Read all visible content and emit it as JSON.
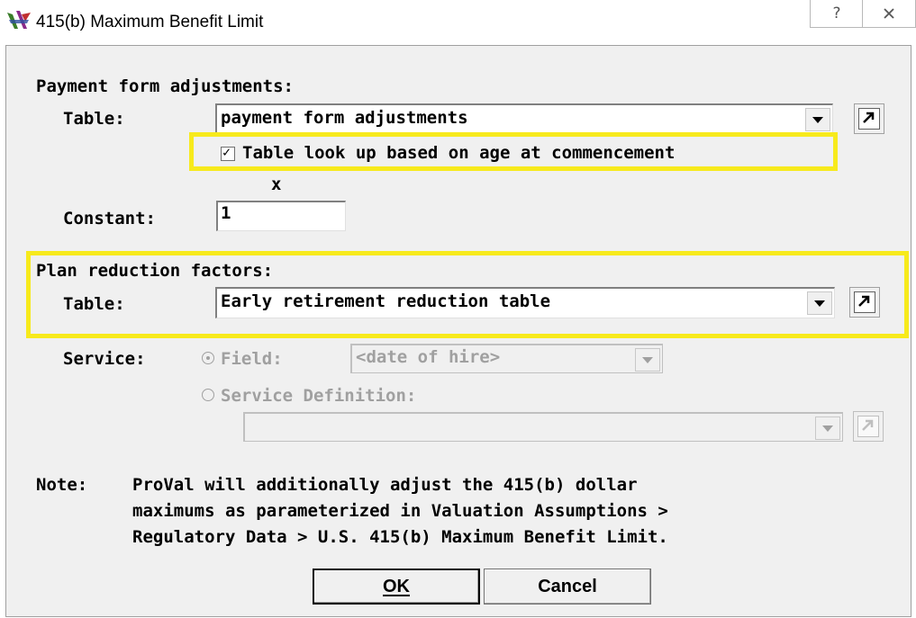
{
  "window": {
    "title": "415(b) Maximum Benefit Limit",
    "icon": "proval-icon",
    "help_glyph": "ଝ",
    "close_glyph": "✕"
  },
  "payment_form": {
    "heading": "Payment form adjustments:",
    "table_label": "Table:",
    "table_value": "payment form adjustments",
    "checkbox_label": "Table look up based on age at commencement",
    "checkbox_checked": true,
    "times": "x",
    "constant_label": "Constant:",
    "constant_value": "1"
  },
  "plan_reduction": {
    "heading": "Plan reduction factors:",
    "table_label": "Table:",
    "table_value": "Early retirement reduction table"
  },
  "service": {
    "label": "Service:",
    "field_option": "Field:",
    "field_value": "<date of hire>",
    "service_def_option": "Service Definition:",
    "service_def_value": ""
  },
  "note": {
    "label": "Note:",
    "lines": [
      "ProVal will additionally adjust the 415(b) dollar",
      "maximums as parameterized in Valuation Assumptions >",
      "Regulatory Data > U.S. 415(b) Maximum Benefit Limit."
    ]
  },
  "buttons": {
    "ok": "OK",
    "cancel": "Cancel"
  },
  "colors": {
    "highlight": "#f7ea1c",
    "dialog_bg": "#f0f0f0",
    "disabled_text": "#a0a0a0"
  }
}
